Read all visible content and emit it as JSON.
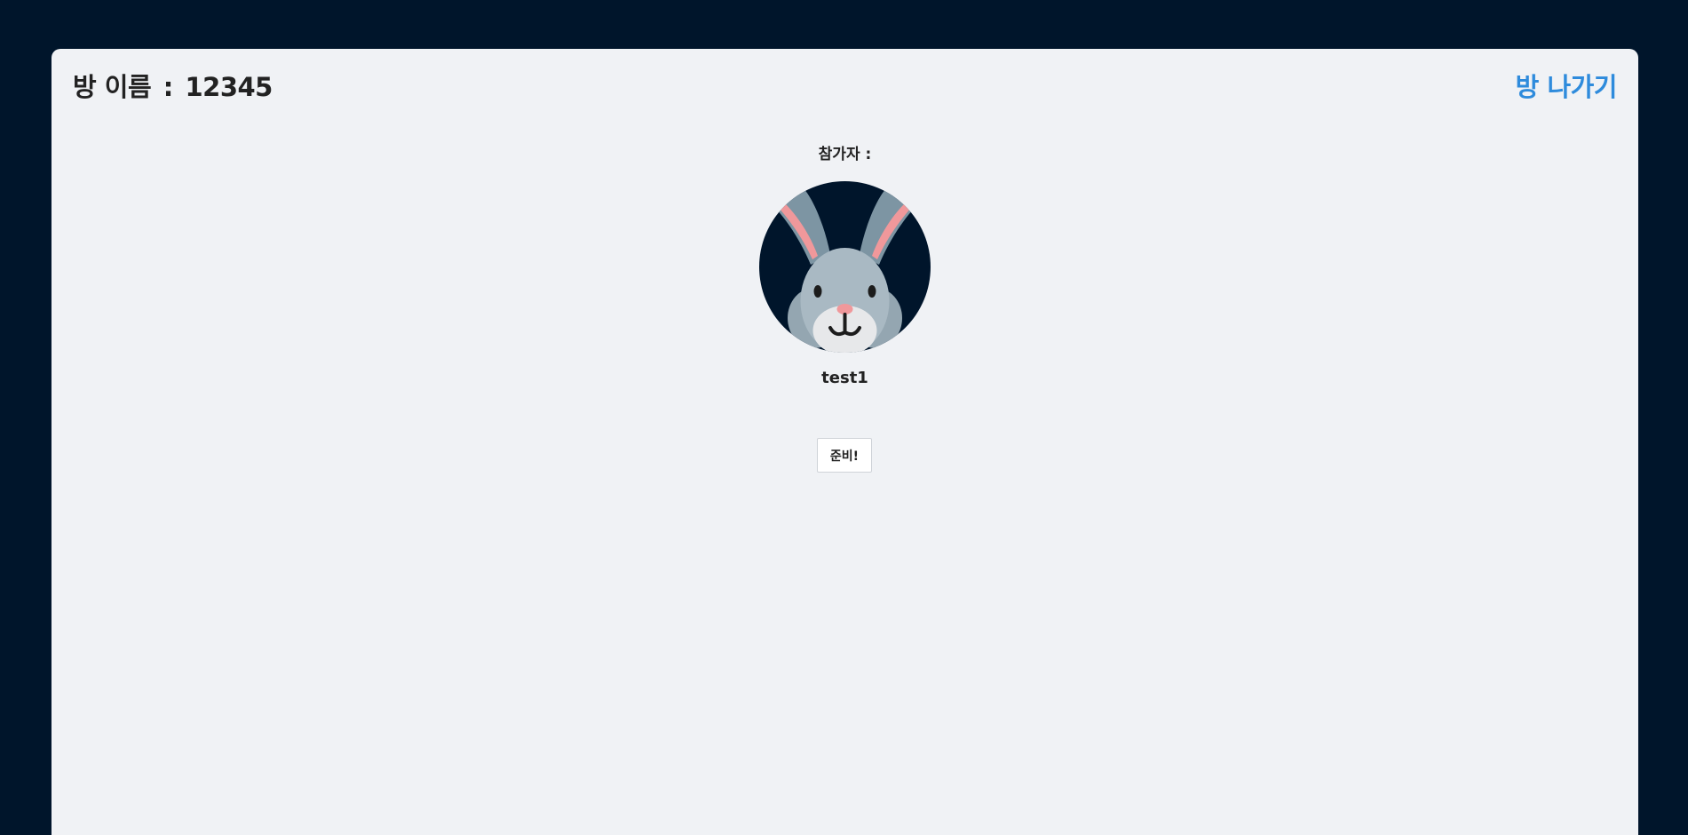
{
  "header": {
    "room_label": "방 이름",
    "separator": ":",
    "room_name": "12345",
    "leave_label": "방 나가기"
  },
  "participants": {
    "label": "참가자 :",
    "list": [
      {
        "name": "test1",
        "avatar_icon": "rabbit-icon"
      }
    ]
  },
  "actions": {
    "ready_label": "준비!"
  },
  "colors": {
    "page_background": "#00152b",
    "panel_background": "#f0f2f5",
    "link_accent": "#2e8bdc",
    "text_primary": "#222222"
  }
}
